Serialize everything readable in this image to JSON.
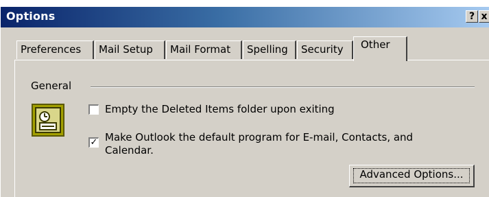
{
  "window": {
    "title": "Options",
    "help_button": "?",
    "close_button": "x"
  },
  "tabs": [
    {
      "label": "Preferences",
      "active": false
    },
    {
      "label": "Mail Setup",
      "active": false
    },
    {
      "label": "Mail Format",
      "active": false
    },
    {
      "label": "Spelling",
      "active": false
    },
    {
      "label": "Security",
      "active": false
    },
    {
      "label": "Other",
      "active": true
    }
  ],
  "general": {
    "group_label": "General",
    "icon": "outlook-options-icon",
    "empty_deleted": {
      "label": "Empty the Deleted Items folder upon exiting",
      "checked": false
    },
    "default_program": {
      "label": "Make Outlook the default program for E-mail, Contacts, and Calendar.",
      "checked": true
    },
    "advanced_button": "Advanced Options..."
  },
  "colors": {
    "titlebar_start": "#0a246a",
    "titlebar_end": "#a6caf0",
    "face": "#d4d0c8",
    "icon_fill": "#a3a000"
  }
}
